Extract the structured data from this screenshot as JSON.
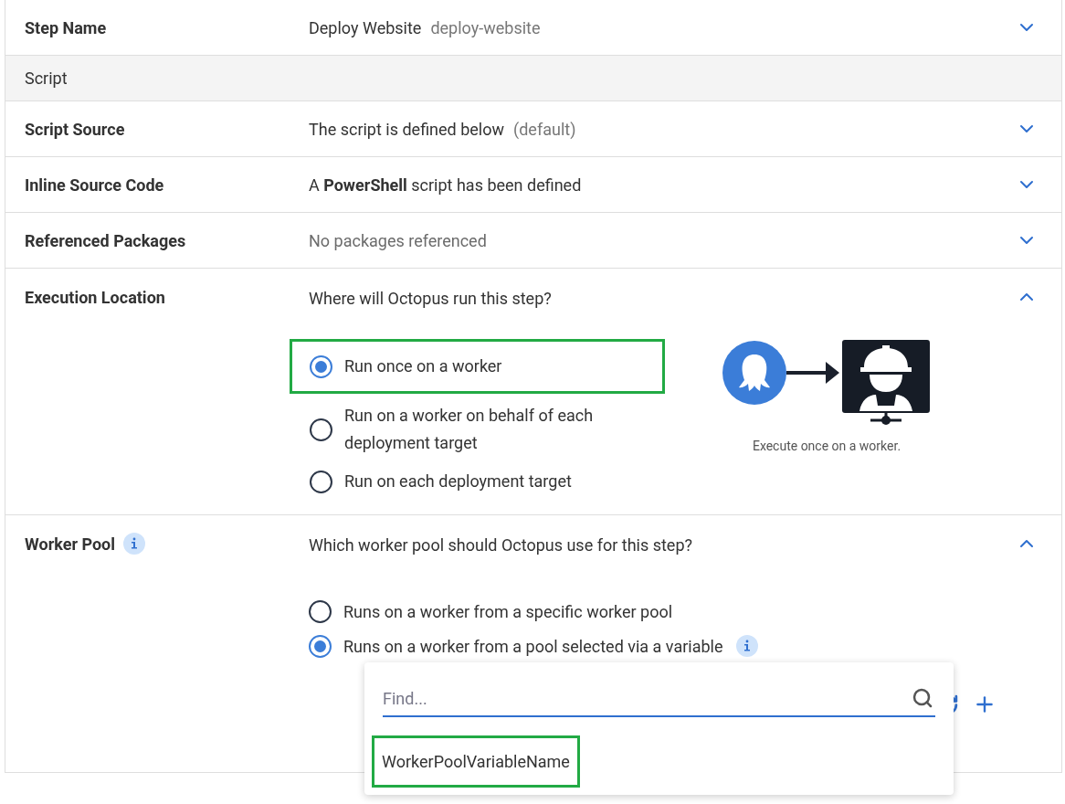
{
  "rows": [
    {
      "kind": "summary",
      "label": "Step Name",
      "value": "Deploy Website",
      "note": "deploy-website",
      "muted": false,
      "expanded": false
    },
    {
      "kind": "section",
      "label": "Script"
    },
    {
      "kind": "summary",
      "label": "Script Source",
      "value": "The script is defined below",
      "note": "(default)",
      "muted": false,
      "expanded": false
    },
    {
      "kind": "summary",
      "label": "Inline Source Code",
      "value": "A **PowerShell** script has been defined",
      "muted": false,
      "expanded": false
    },
    {
      "kind": "summary",
      "label": "Referenced Packages",
      "value": "No packages referenced",
      "muted": true,
      "expanded": false
    },
    {
      "kind": "execution",
      "label": "Execution Location",
      "question": "Where will Octopus run this step?",
      "expanded": true,
      "options": [
        {
          "label": "Run once on a worker",
          "selected": true,
          "highlighted": true
        },
        {
          "label": "Run on a worker on behalf of each deployment target",
          "selected": false,
          "highlighted": false
        },
        {
          "label": "Run on each deployment target",
          "selected": false,
          "highlighted": false
        }
      ],
      "illustration": {
        "caption": "Execute once on a worker."
      }
    },
    {
      "kind": "pool",
      "label": "Worker Pool",
      "info": true,
      "question": "Which worker pool should Octopus use for this step?",
      "expanded": true,
      "options": [
        {
          "label": "Runs on a worker from a specific worker pool",
          "selected": false,
          "info": false
        },
        {
          "label": "Runs on a worker from a pool selected via a variable",
          "selected": true,
          "info": true
        }
      ],
      "dropdown": {
        "placeholder": "Find...",
        "items": [
          {
            "label": "WorkerPoolVariableName",
            "highlighted": true
          }
        ]
      }
    }
  ]
}
